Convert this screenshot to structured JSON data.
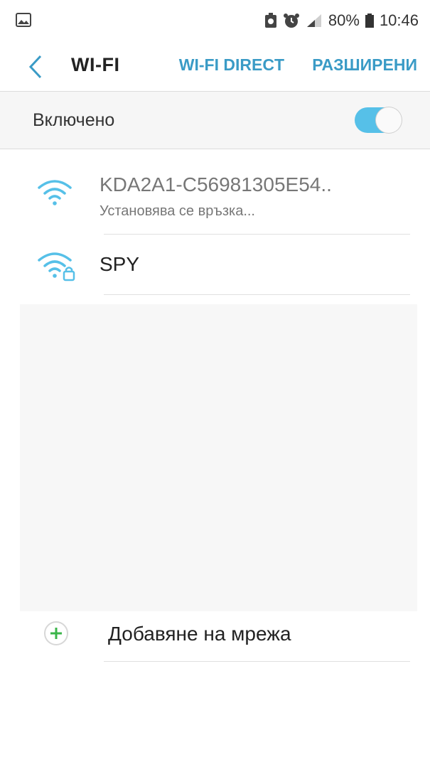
{
  "status_bar": {
    "battery_percent": "80%",
    "time": "10:46"
  },
  "app_bar": {
    "title": "WI-FI",
    "wifi_direct_label": "WI-FI DIRECT",
    "advanced_label": "РАЗШИРЕНИ"
  },
  "master_switch": {
    "label": "Включено",
    "on": true
  },
  "networks": [
    {
      "name": "KDA2A1-C56981305E54..",
      "status": "Установява се връзка...",
      "secured": false
    },
    {
      "name": "SPY",
      "status": "",
      "secured": true
    }
  ],
  "add_network": {
    "label": "Добавяне на мрежа"
  },
  "colors": {
    "accent": "#3a9bc6",
    "wifi_icon": "#56c0e8",
    "toggle_on": "#56c0e8",
    "add_icon": "#3bb54a"
  }
}
